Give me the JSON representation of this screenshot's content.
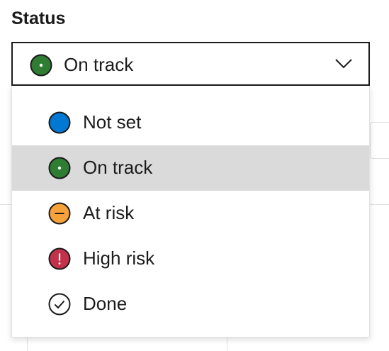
{
  "field": {
    "label": "Status"
  },
  "select": {
    "value": "On track",
    "icon": "on-track-icon",
    "chevron_icon": "chevron-down-icon"
  },
  "menu": {
    "selected_index": 1,
    "items": [
      {
        "label": "Not set",
        "icon": "not-set-icon",
        "color": "#0078d4"
      },
      {
        "label": "On track",
        "icon": "on-track-icon",
        "color": "#2e7d32"
      },
      {
        "label": "At risk",
        "icon": "at-risk-icon",
        "color": "#f7a13a"
      },
      {
        "label": "High risk",
        "icon": "high-risk-icon",
        "color": "#c4314b"
      },
      {
        "label": "Done",
        "icon": "done-check-icon",
        "color": "#ffffff"
      }
    ]
  },
  "colors": {
    "border": "#1b1b1b",
    "selected_background": "#dadada",
    "text": "#1b1b1b"
  }
}
